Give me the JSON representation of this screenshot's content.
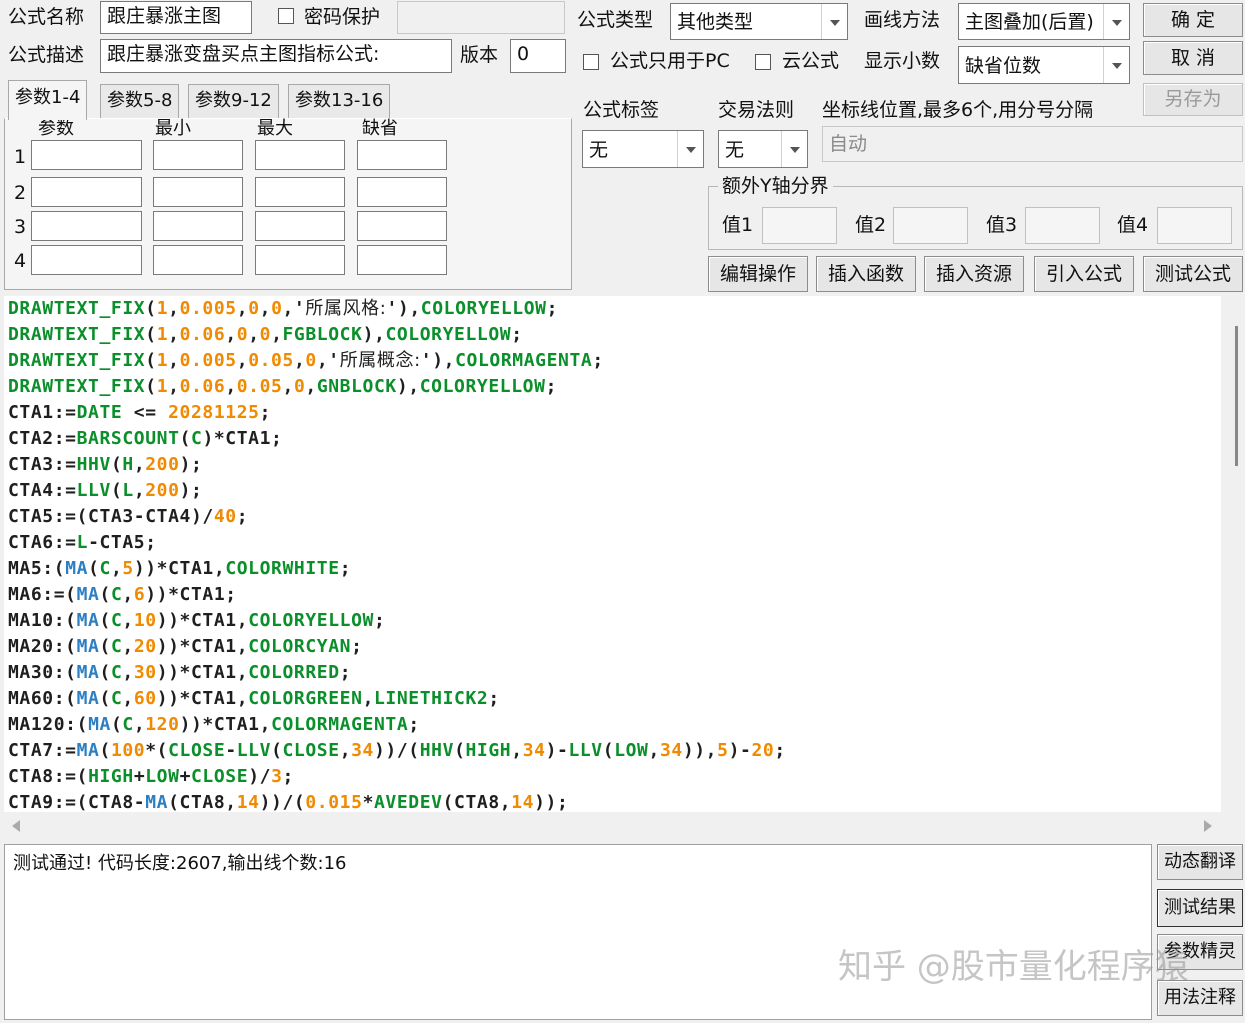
{
  "header": {
    "name_label": "公式名称",
    "name_value": "跟庄暴涨主图",
    "password_label": "密码保护",
    "desc_label": "公式描述",
    "desc_value": "跟庄暴涨变盘买点主图指标公式:",
    "version_label": "版本",
    "version_value": "0",
    "type_label": "公式类型",
    "type_value": "其他类型",
    "draw_label": "画线方法",
    "draw_value": "主图叠加(后置)",
    "pc_only_label": "公式只用于PC",
    "cloud_label": "云公式",
    "decimals_label": "显示小数",
    "decimals_value": "缺省位数"
  },
  "buttons": {
    "ok": "确  定",
    "cancel": "取  消",
    "save_as": "另存为",
    "edit_ops": "编辑操作",
    "insert_func": "插入函数",
    "insert_res": "插入资源",
    "import_formula": "引入公式",
    "test_formula": "测试公式",
    "dyn_translate": "动态翻译",
    "test_result": "测试结果",
    "param_wizard": "参数精灵",
    "usage_note": "用法注释"
  },
  "tabs": [
    "参数1-4",
    "参数5-8",
    "参数9-12",
    "参数13-16"
  ],
  "param_table": {
    "headers": [
      "参数",
      "最小",
      "最大",
      "缺省"
    ],
    "rows": [
      "1",
      "2",
      "3",
      "4"
    ]
  },
  "labels": {
    "formula_tag": "公式标签",
    "formula_tag_value": "无",
    "trade_rule": "交易法则",
    "trade_rule_value": "无",
    "axis_pos": "坐标线位置,最多6个,用分号分隔",
    "axis_pos_value": "自动",
    "extra_y": "额外Y轴分界",
    "val1": "值1",
    "val2": "值2",
    "val3": "值3",
    "val4": "值4"
  },
  "code_lines": [
    [
      [
        "DRAWTEXT_FIX",
        "f"
      ],
      [
        "(",
        "k"
      ],
      [
        "1",
        "n"
      ],
      [
        ",",
        "k"
      ],
      [
        "0.005",
        "n"
      ],
      [
        ",",
        "k"
      ],
      [
        "0",
        "n"
      ],
      [
        ",",
        "k"
      ],
      [
        "0",
        "n"
      ],
      [
        ",'",
        "k"
      ],
      [
        "所属风格:",
        "s"
      ],
      [
        "'),",
        "k"
      ],
      [
        "COLORYELLOW",
        "f"
      ],
      [
        ";",
        "k"
      ]
    ],
    [
      [
        "DRAWTEXT_FIX",
        "f"
      ],
      [
        "(",
        "k"
      ],
      [
        "1",
        "n"
      ],
      [
        ",",
        "k"
      ],
      [
        "0.06",
        "n"
      ],
      [
        ",",
        "k"
      ],
      [
        "0",
        "n"
      ],
      [
        ",",
        "k"
      ],
      [
        "0",
        "n"
      ],
      [
        ",",
        "k"
      ],
      [
        "FGBLOCK",
        "f"
      ],
      [
        "),",
        "k"
      ],
      [
        "COLORYELLOW",
        "f"
      ],
      [
        ";",
        "k"
      ]
    ],
    [
      [
        "DRAWTEXT_FIX",
        "f"
      ],
      [
        "(",
        "k"
      ],
      [
        "1",
        "n"
      ],
      [
        ",",
        "k"
      ],
      [
        "0.005",
        "n"
      ],
      [
        ",",
        "k"
      ],
      [
        "0.05",
        "n"
      ],
      [
        ",",
        "k"
      ],
      [
        "0",
        "n"
      ],
      [
        ",'",
        "k"
      ],
      [
        "所属概念:",
        "s"
      ],
      [
        "'),",
        "k"
      ],
      [
        "COLORMAGENTA",
        "f"
      ],
      [
        ";",
        "k"
      ]
    ],
    [
      [
        "DRAWTEXT_FIX",
        "f"
      ],
      [
        "(",
        "k"
      ],
      [
        "1",
        "n"
      ],
      [
        ",",
        "k"
      ],
      [
        "0.06",
        "n"
      ],
      [
        ",",
        "k"
      ],
      [
        "0.05",
        "n"
      ],
      [
        ",",
        "k"
      ],
      [
        "0",
        "n"
      ],
      [
        ",",
        "k"
      ],
      [
        "GNBLOCK",
        "f"
      ],
      [
        "),",
        "k"
      ],
      [
        "COLORYELLOW",
        "f"
      ],
      [
        ";",
        "k"
      ]
    ],
    [
      [
        "CTA1:=",
        "k"
      ],
      [
        "DATE",
        "f"
      ],
      [
        " <= ",
        "k"
      ],
      [
        "20281125",
        "n"
      ],
      [
        ";",
        "k"
      ]
    ],
    [
      [
        "CTA2:=",
        "k"
      ],
      [
        "BARSCOUNT",
        "f"
      ],
      [
        "(",
        "k"
      ],
      [
        "C",
        "f"
      ],
      [
        ")*CTA1;",
        "k"
      ]
    ],
    [
      [
        "CTA3:=",
        "k"
      ],
      [
        "HHV",
        "f"
      ],
      [
        "(",
        "k"
      ],
      [
        "H",
        "f"
      ],
      [
        ",",
        "k"
      ],
      [
        "200",
        "n"
      ],
      [
        ");",
        "k"
      ]
    ],
    [
      [
        "CTA4:=",
        "k"
      ],
      [
        "LLV",
        "f"
      ],
      [
        "(",
        "k"
      ],
      [
        "L",
        "f"
      ],
      [
        ",",
        "k"
      ],
      [
        "200",
        "n"
      ],
      [
        ");",
        "k"
      ]
    ],
    [
      [
        "CTA5:=(CTA3-CTA4)/",
        "k"
      ],
      [
        "40",
        "n"
      ],
      [
        ";",
        "k"
      ]
    ],
    [
      [
        "CTA6:=",
        "k"
      ],
      [
        "L",
        "f"
      ],
      [
        "-CTA5;",
        "k"
      ]
    ],
    [
      [
        "MA5:(",
        "k"
      ],
      [
        "MA",
        "b"
      ],
      [
        "(",
        "k"
      ],
      [
        "C",
        "f"
      ],
      [
        ",",
        "k"
      ],
      [
        "5",
        "n"
      ],
      [
        "))*CTA1,",
        "k"
      ],
      [
        "COLORWHITE",
        "f"
      ],
      [
        ";",
        "k"
      ]
    ],
    [
      [
        "MA6:=(",
        "k"
      ],
      [
        "MA",
        "b"
      ],
      [
        "(",
        "k"
      ],
      [
        "C",
        "f"
      ],
      [
        ",",
        "k"
      ],
      [
        "6",
        "n"
      ],
      [
        "))*CTA1;",
        "k"
      ]
    ],
    [
      [
        "MA10:(",
        "k"
      ],
      [
        "MA",
        "b"
      ],
      [
        "(",
        "k"
      ],
      [
        "C",
        "f"
      ],
      [
        ",",
        "k"
      ],
      [
        "10",
        "n"
      ],
      [
        "))*CTA1,",
        "k"
      ],
      [
        "COLORYELLOW",
        "f"
      ],
      [
        ";",
        "k"
      ]
    ],
    [
      [
        "MA20:(",
        "k"
      ],
      [
        "MA",
        "b"
      ],
      [
        "(",
        "k"
      ],
      [
        "C",
        "f"
      ],
      [
        ",",
        "k"
      ],
      [
        "20",
        "n"
      ],
      [
        "))*CTA1,",
        "k"
      ],
      [
        "COLORCYAN",
        "f"
      ],
      [
        ";",
        "k"
      ]
    ],
    [
      [
        "MA30:(",
        "k"
      ],
      [
        "MA",
        "b"
      ],
      [
        "(",
        "k"
      ],
      [
        "C",
        "f"
      ],
      [
        ",",
        "k"
      ],
      [
        "30",
        "n"
      ],
      [
        "))*CTA1,",
        "k"
      ],
      [
        "COLORRED",
        "f"
      ],
      [
        ";",
        "k"
      ]
    ],
    [
      [
        "MA60:(",
        "k"
      ],
      [
        "MA",
        "b"
      ],
      [
        "(",
        "k"
      ],
      [
        "C",
        "f"
      ],
      [
        ",",
        "k"
      ],
      [
        "60",
        "n"
      ],
      [
        "))*CTA1,",
        "k"
      ],
      [
        "COLORGREEN",
        "f"
      ],
      [
        ",",
        "k"
      ],
      [
        "LINETHICK2",
        "f"
      ],
      [
        ";",
        "k"
      ]
    ],
    [
      [
        "MA120:(",
        "k"
      ],
      [
        "MA",
        "b"
      ],
      [
        "(",
        "k"
      ],
      [
        "C",
        "f"
      ],
      [
        ",",
        "k"
      ],
      [
        "120",
        "n"
      ],
      [
        "))*CTA1,",
        "k"
      ],
      [
        "COLORMAGENTA",
        "f"
      ],
      [
        ";",
        "k"
      ]
    ],
    [
      [
        "CTA7:=",
        "k"
      ],
      [
        "MA",
        "b"
      ],
      [
        "(",
        "k"
      ],
      [
        "100",
        "n"
      ],
      [
        "*(",
        "k"
      ],
      [
        "CLOSE",
        "f"
      ],
      [
        "-",
        "k"
      ],
      [
        "LLV",
        "f"
      ],
      [
        "(",
        "k"
      ],
      [
        "CLOSE",
        "f"
      ],
      [
        ",",
        "k"
      ],
      [
        "34",
        "n"
      ],
      [
        "))/(",
        "k"
      ],
      [
        "HHV",
        "f"
      ],
      [
        "(",
        "k"
      ],
      [
        "HIGH",
        "f"
      ],
      [
        ",",
        "k"
      ],
      [
        "34",
        "n"
      ],
      [
        ")-",
        "k"
      ],
      [
        "LLV",
        "f"
      ],
      [
        "(",
        "k"
      ],
      [
        "LOW",
        "f"
      ],
      [
        ",",
        "k"
      ],
      [
        "34",
        "n"
      ],
      [
        ")),",
        "k"
      ],
      [
        "5",
        "n"
      ],
      [
        ")-",
        "k"
      ],
      [
        "20",
        "n"
      ],
      [
        ";",
        "k"
      ]
    ],
    [
      [
        "CTA8:=(",
        "k"
      ],
      [
        "HIGH",
        "f"
      ],
      [
        "+",
        "k"
      ],
      [
        "LOW",
        "f"
      ],
      [
        "+",
        "k"
      ],
      [
        "CLOSE",
        "f"
      ],
      [
        ")/",
        "k"
      ],
      [
        "3",
        "n"
      ],
      [
        ";",
        "k"
      ]
    ],
    [
      [
        "CTA9:=(CTA8-",
        "k"
      ],
      [
        "MA",
        "b"
      ],
      [
        "(CTA8,",
        "k"
      ],
      [
        "14",
        "n"
      ],
      [
        "))/(",
        "k"
      ],
      [
        "0.015",
        "n"
      ],
      [
        "*",
        "k"
      ],
      [
        "AVEDEV",
        "f"
      ],
      [
        "(CTA8,",
        "k"
      ],
      [
        "14",
        "n"
      ],
      [
        "));",
        "k"
      ]
    ]
  ],
  "colors": {
    "default": "#1f1f1f",
    "function": "#0a8f2a",
    "number": "#f08a00",
    "builtin": "#2b7fc2"
  },
  "result_text": "测试通过! 代码长度:2607,输出线个数:16",
  "watermark": "知乎 @股市量化程序猿"
}
